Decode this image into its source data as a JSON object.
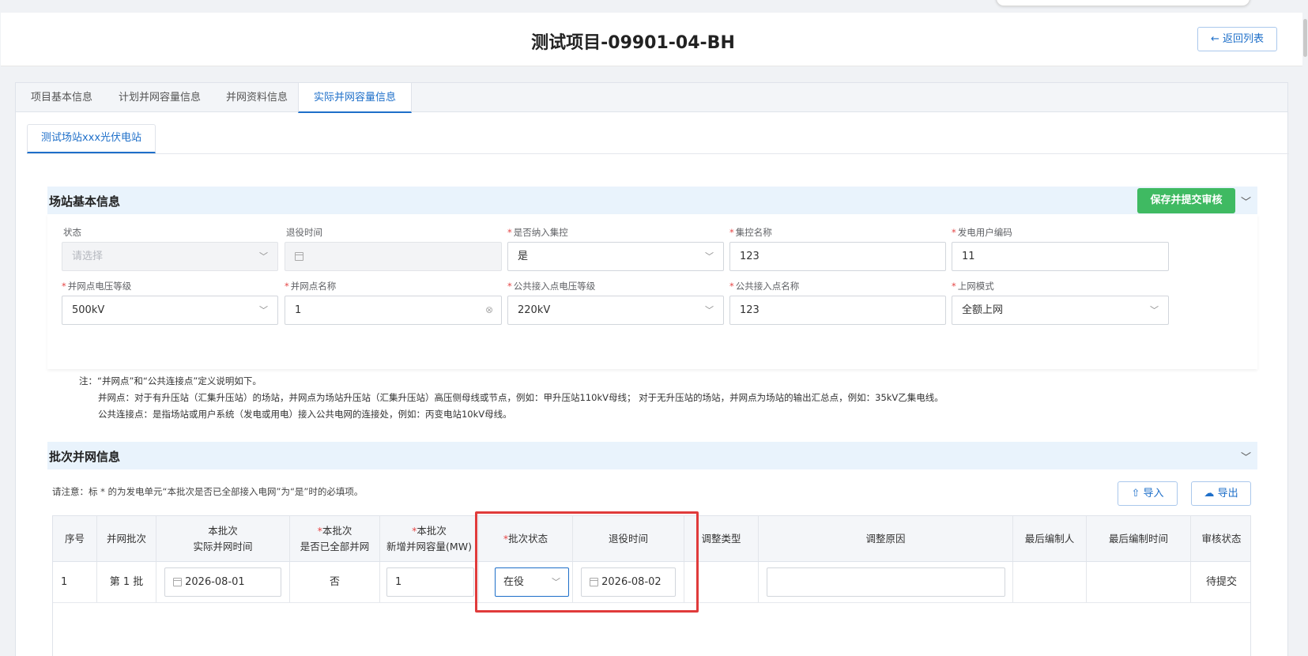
{
  "header": {
    "title": "测试项目-09901-04-BH",
    "back_label": "← 返回列表"
  },
  "tabs": [
    {
      "label": "项目基本信息"
    },
    {
      "label": "计划并网容量信息"
    },
    {
      "label": "并网资料信息"
    },
    {
      "label": "实际并网容量信息"
    }
  ],
  "station_tab": "测试场站xxx光伏电站",
  "station_section": {
    "title": "场站基本信息",
    "save_label": "保存并提交审核",
    "fields": [
      {
        "label": "状态",
        "required": "",
        "value": "请选择"
      },
      {
        "label": "退役时间",
        "required": "",
        "value": ""
      },
      {
        "label": "是否纳入集控",
        "required": "*",
        "value": "是"
      },
      {
        "label": "集控名称",
        "required": "*",
        "value": "123"
      },
      {
        "label": "发电用户编码",
        "required": "*",
        "value": "11"
      },
      {
        "label": "并网点电压等级",
        "required": "*",
        "value": "500kV"
      },
      {
        "label": "并网点名称",
        "required": "*",
        "value": "1"
      },
      {
        "label": "公共接入点电压等级",
        "required": "*",
        "value": "220kV"
      },
      {
        "label": "公共接入点名称",
        "required": "*",
        "value": "123"
      },
      {
        "label": "上网模式",
        "required": "*",
        "value": "全额上网"
      }
    ]
  },
  "note": {
    "line1": "注：“并网点”和“公共连接点”定义说明如下。",
    "line2": "并网点：对于有升压站（汇集升压站）的场站，并网点为场站升压站（汇集升压站）高压侧母线或节点，例如：甲升压站110kV母线；  对于无升压站的场站，并网点为场站的输出汇总点，例如：35kV乙集电线。",
    "line3": "公共连接点：是指场站或用户系统（发电或用电）接入公共电网的连接处，例如：丙变电站10kV母线。"
  },
  "batch_section": {
    "title": "批次并网信息",
    "hint": "请注意：标 * 的为发电单元“本批次是否已全部接入电网”为“是”时的必填项。",
    "import_label": "导入",
    "export_label": "导出",
    "columns": {
      "seq": "序号",
      "batch": "并网批次",
      "actual_time_l1": "本批次",
      "actual_time_l2": "实际并网时间",
      "all_connected_l1": "本批次",
      "all_connected_l2": "是否已全部并网",
      "new_capacity_l1": "本批次",
      "new_capacity_l2": "新增并网容量(MW)",
      "batch_status": "批次状态",
      "retire_time": "退役时间",
      "adjust_type": "调整类型",
      "adjust_reason": "调整原因",
      "last_editor": "最后编制人",
      "last_edit_time": "最后编制时间",
      "review_status": "审核状态"
    },
    "rows": [
      {
        "seq": "1",
        "batch": "第 1 批",
        "actual_time": "2026-08-01",
        "all_connected": "否",
        "new_capacity": "1",
        "batch_status": "在役",
        "retire_time": "2026-08-02",
        "adjust_type": "",
        "adjust_reason": "",
        "last_editor": "",
        "last_edit_time": "",
        "review_status": "待提交"
      }
    ]
  },
  "colors": {
    "accent": "#1e6fc9",
    "save_green": "#3fba62",
    "highlight_red": "#e03b3b",
    "section_bg": "#e9f3fc"
  }
}
